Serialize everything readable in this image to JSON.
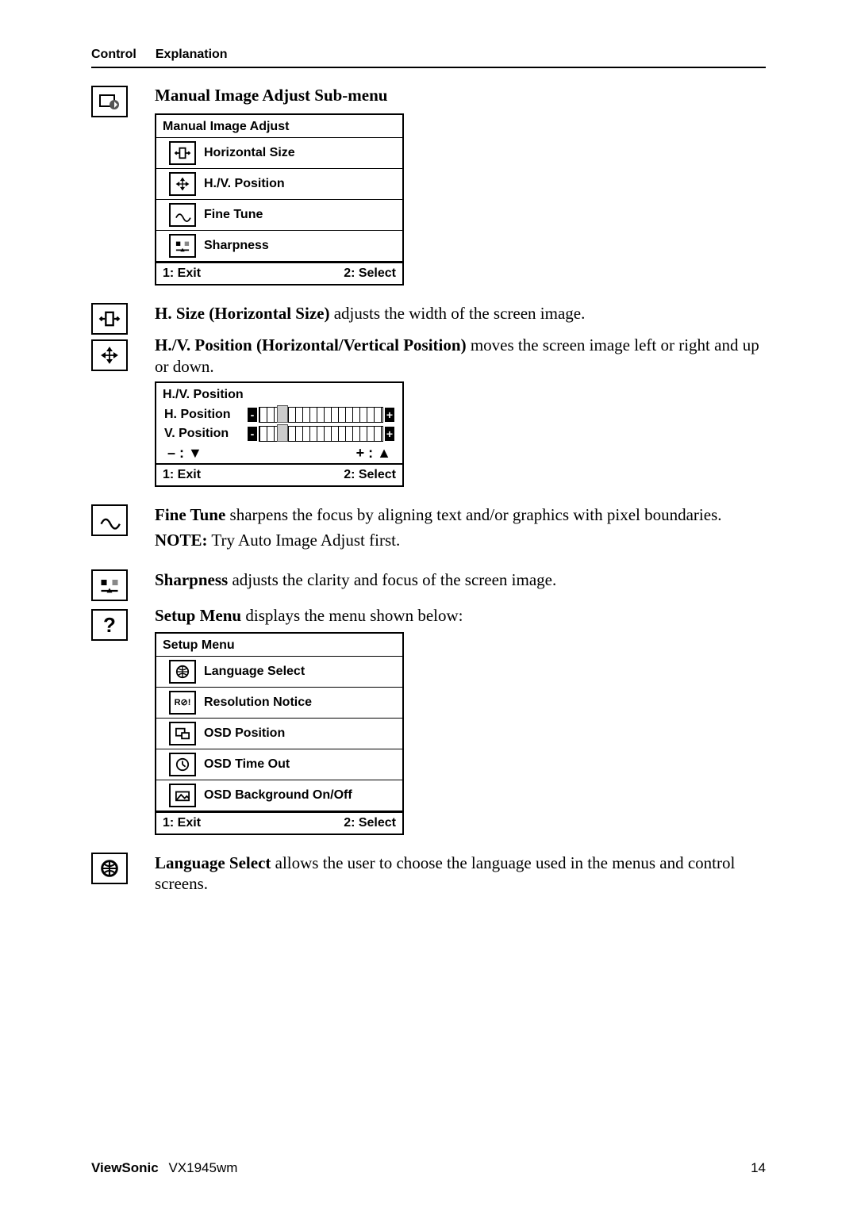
{
  "header": {
    "col1": "Control",
    "col2": "Explanation"
  },
  "manual_adjust": {
    "title": "Manual Image Adjust Sub-menu",
    "panel_title": "Manual Image Adjust",
    "items": [
      {
        "label": "Horizontal Size"
      },
      {
        "label": "H./V. Position"
      },
      {
        "label": "Fine Tune"
      },
      {
        "label": "Sharpness"
      }
    ],
    "footer_left": "1: Exit",
    "footer_right": "2: Select"
  },
  "hsize": {
    "bold": "H. Size (Horizontal Size)",
    "rest": " adjusts the width of the screen image."
  },
  "hvpos": {
    "bold": "H./V. Position (Horizontal/Vertical Position)",
    "rest": " moves the screen image left or right and up or down.",
    "panel_title": "H./V. Position",
    "h_label": "H. Position",
    "v_label": "V. Position",
    "minus_ctrl": "– : ▼",
    "plus_ctrl": "+ : ▲",
    "footer_left": "1: Exit",
    "footer_right": "2: Select"
  },
  "finetune": {
    "bold": "Fine Tune",
    "rest": " sharpens the focus by aligning text and/or graphics with pixel boundaries.",
    "note_bold": "NOTE:",
    "note_rest": " Try Auto Image Adjust first."
  },
  "sharpness": {
    "bold": "Sharpness",
    "rest": " adjusts the clarity and focus of the screen image."
  },
  "setup": {
    "bold": "Setup Menu",
    "rest": " displays the menu shown below:",
    "panel_title": "Setup Menu",
    "items": [
      {
        "label": "Language Select"
      },
      {
        "label": "Resolution Notice"
      },
      {
        "label": "OSD Position"
      },
      {
        "label": "OSD Time Out"
      },
      {
        "label": "OSD Background On/Off"
      }
    ],
    "footer_left": "1: Exit",
    "footer_right": "2: Select"
  },
  "language": {
    "bold": "Language Select",
    "rest": " allows the user to choose the language used in the menus and control screens."
  },
  "footer": {
    "brand": "ViewSonic",
    "model": "VX1945wm",
    "pageno": "14"
  }
}
